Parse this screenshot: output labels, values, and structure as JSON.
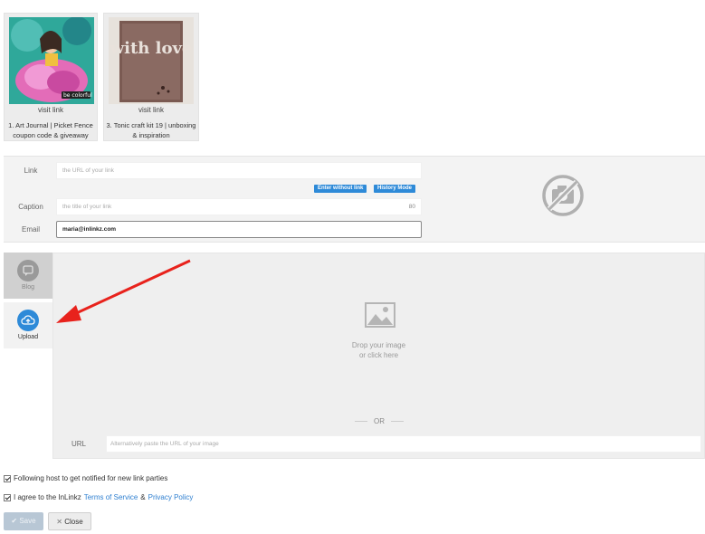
{
  "thumbnails": [
    {
      "visit_label": "visit link",
      "caption": "1. Art Journal | Picket Fence coupon code & giveaway",
      "overlay_text": "be colorful"
    },
    {
      "visit_label": "visit link",
      "caption": "3. Tonic craft kit 19 | unboxing & inspiration",
      "overlay_text": "with love"
    }
  ],
  "form": {
    "link_label": "Link",
    "link_placeholder": "the URL of your link",
    "enter_without_link": "Enter without link",
    "history_mode": "History Mode",
    "caption_label": "Caption",
    "caption_placeholder": "the title of your link",
    "caption_count": "80",
    "email_label": "Email",
    "email_value": "maria@inlinkz.com"
  },
  "tabs": {
    "blog": "Blog",
    "upload": "Upload"
  },
  "upload": {
    "drop_line1": "Drop your image",
    "drop_line2": "or click here",
    "or": "OR",
    "url_label": "URL",
    "url_placeholder": "Alternatively paste the URL of your image"
  },
  "checks": {
    "follow": "Following host to get notified for new link parties",
    "agree_prefix": "I agree to the InLinkz",
    "terms": "Terms of Service",
    "amp": "&",
    "privacy": "Privacy Policy"
  },
  "buttons": {
    "save": "Save",
    "close": "Close"
  },
  "colors": {
    "accent": "#2e8ad8",
    "arrow": "#e8221c"
  }
}
